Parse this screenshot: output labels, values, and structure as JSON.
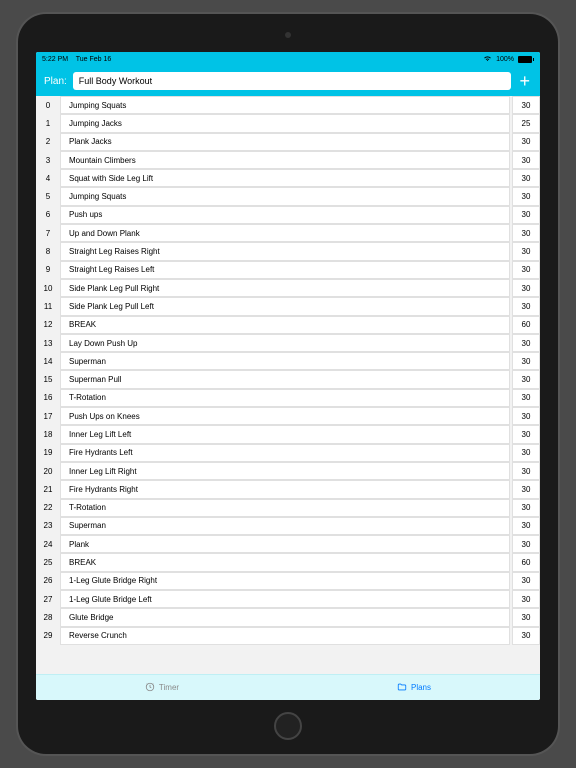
{
  "statusbar": {
    "time": "5:22 PM",
    "date": "Tue Feb 16",
    "battery": "100%"
  },
  "navbar": {
    "plan_label": "Plan:",
    "plan_value": "Full Body Workout",
    "add_label": "+"
  },
  "exercises": [
    {
      "idx": "0",
      "name": "Jumping Squats",
      "dur": "30"
    },
    {
      "idx": "1",
      "name": "Jumping Jacks",
      "dur": "25"
    },
    {
      "idx": "2",
      "name": "Plank Jacks",
      "dur": "30"
    },
    {
      "idx": "3",
      "name": "Mountain Climbers",
      "dur": "30"
    },
    {
      "idx": "4",
      "name": "Squat with Side Leg Lift",
      "dur": "30"
    },
    {
      "idx": "5",
      "name": "Jumping Squats",
      "dur": "30"
    },
    {
      "idx": "6",
      "name": "Push ups",
      "dur": "30"
    },
    {
      "idx": "7",
      "name": "Up and Down Plank",
      "dur": "30"
    },
    {
      "idx": "8",
      "name": "Straight Leg Raises Right",
      "dur": "30"
    },
    {
      "idx": "9",
      "name": "Straight Leg Raises Left",
      "dur": "30"
    },
    {
      "idx": "10",
      "name": "Side Plank Leg Pull Right",
      "dur": "30"
    },
    {
      "idx": "11",
      "name": "Side Plank Leg Pull Left",
      "dur": "30"
    },
    {
      "idx": "12",
      "name": "BREAK",
      "dur": "60"
    },
    {
      "idx": "13",
      "name": "Lay Down Push Up",
      "dur": "30"
    },
    {
      "idx": "14",
      "name": "Superman",
      "dur": "30"
    },
    {
      "idx": "15",
      "name": "Superman Pull",
      "dur": "30"
    },
    {
      "idx": "16",
      "name": "T-Rotation",
      "dur": "30"
    },
    {
      "idx": "17",
      "name": "Push Ups on Knees",
      "dur": "30"
    },
    {
      "idx": "18",
      "name": "Inner Leg Lift Left",
      "dur": "30"
    },
    {
      "idx": "19",
      "name": "Fire Hydrants Left",
      "dur": "30"
    },
    {
      "idx": "20",
      "name": "Inner Leg Lift Right",
      "dur": "30"
    },
    {
      "idx": "21",
      "name": "Fire Hydrants Right",
      "dur": "30"
    },
    {
      "idx": "22",
      "name": "T-Rotation",
      "dur": "30"
    },
    {
      "idx": "23",
      "name": "Superman",
      "dur": "30"
    },
    {
      "idx": "24",
      "name": "Plank",
      "dur": "30"
    },
    {
      "idx": "25",
      "name": "BREAK",
      "dur": "60"
    },
    {
      "idx": "26",
      "name": "1-Leg Glute Bridge Right",
      "dur": "30"
    },
    {
      "idx": "27",
      "name": "1-Leg Glute Bridge Left",
      "dur": "30"
    },
    {
      "idx": "28",
      "name": "Glute Bridge",
      "dur": "30"
    },
    {
      "idx": "29",
      "name": "Reverse Crunch",
      "dur": "30"
    }
  ],
  "tabs": {
    "timer": "Timer",
    "plans": "Plans"
  }
}
